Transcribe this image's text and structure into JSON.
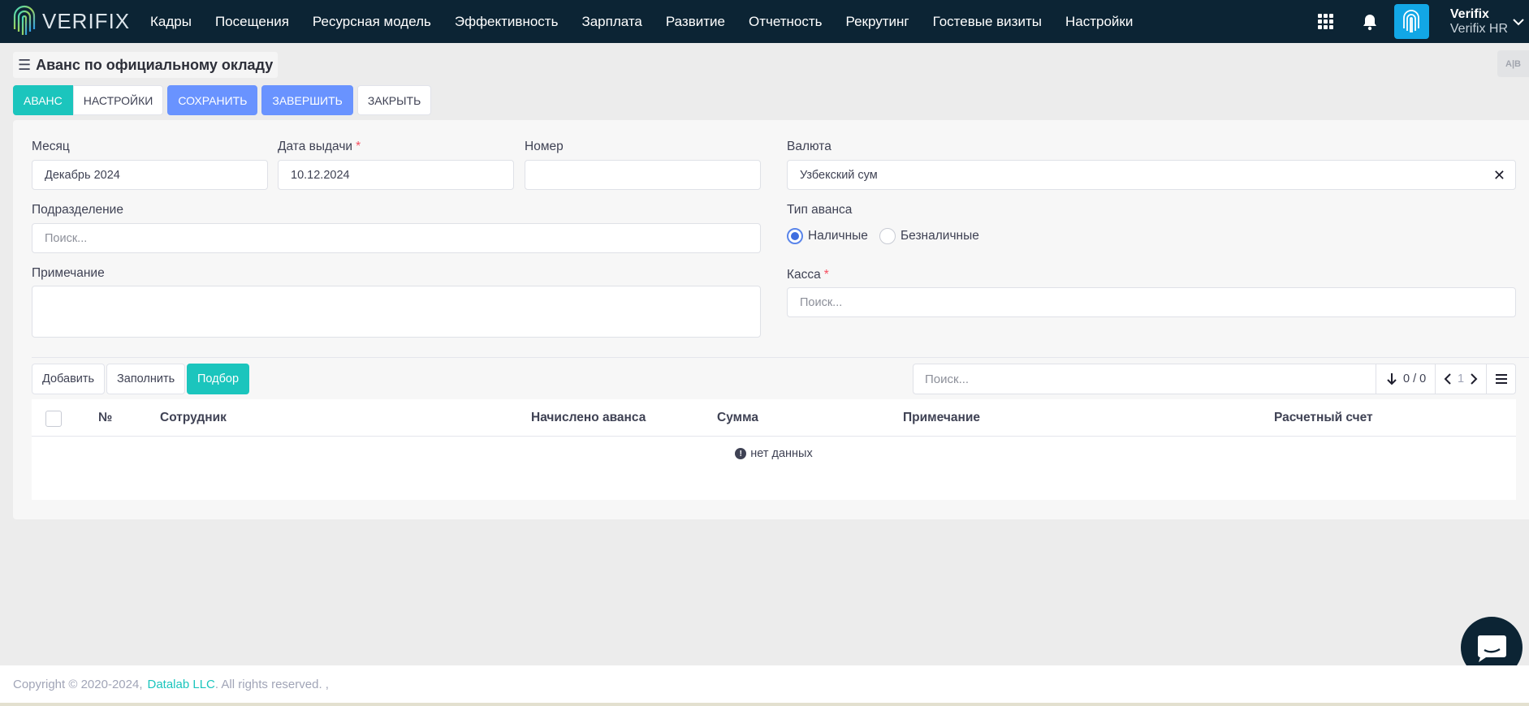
{
  "brand": {
    "name": "VERIFIX"
  },
  "nav": {
    "items": [
      "Кадры",
      "Посещения",
      "Ресурсная модель",
      "Эффективность",
      "Зарплата",
      "Развитие",
      "Отчетность",
      "Рекрутинг",
      "Гостевые визиты",
      "Настройки"
    ]
  },
  "user": {
    "name": "Verifix",
    "company": "Verifix HR"
  },
  "page": {
    "title": "Аванс по официальному окладу",
    "corner_label": "A|B"
  },
  "tabs": {
    "advance": "АВАНС",
    "settings": "НАСТРОЙКИ",
    "save": "СОХРАНИТЬ",
    "finish": "ЗАВЕРШИТЬ",
    "close": "ЗАКРЫТЬ"
  },
  "form": {
    "month_label": "Месяц",
    "month_value": "Декабрь 2024",
    "issue_date_label": "Дата выдачи",
    "required_mark": "*",
    "issue_date_value": "10.12.2024",
    "number_label": "Номер",
    "number_value": "",
    "currency_label": "Валюта",
    "currency_value": "Узбекский сум",
    "currency_clear": "✕",
    "division_label": "Подразделение",
    "division_placeholder": "Поиск...",
    "advance_type_label": "Тип аванса",
    "advance_type_options": [
      "Наличные",
      "Безналичные"
    ],
    "advance_type_selected": "Наличные",
    "note_label": "Примечание",
    "cash_label": "Касса",
    "cash_placeholder": "Поиск..."
  },
  "grid": {
    "add": "Добавить",
    "fill": "Заполнить",
    "select": "Подбор",
    "search_placeholder": "Поиск...",
    "counter": "0 / 0",
    "page": "1",
    "columns": [
      "№",
      "Сотрудник",
      "Начислено аванса",
      "Сумма",
      "Примечание",
      "Расчетный счет"
    ],
    "empty_text": "нет данных"
  },
  "footer": {
    "copyright": "Copyright © 2020-2024,",
    "company": "Datalab LLC",
    "rights": ". All rights reserved. ,"
  },
  "colors": {
    "nav_bg": "#0c2434",
    "teal": "#1bc5bd",
    "blue": "#6993ff",
    "required": "#f64e60"
  }
}
